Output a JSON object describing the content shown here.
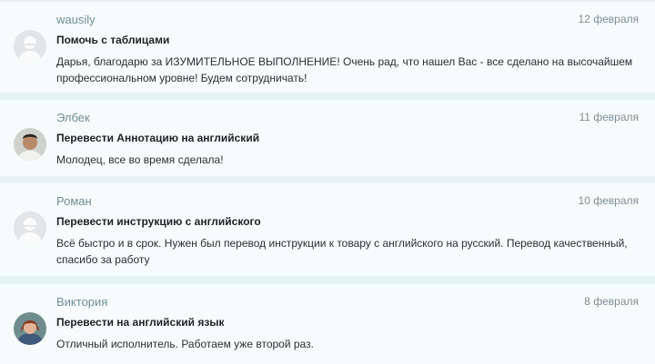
{
  "reviews": [
    {
      "name": "wausily",
      "date": "12 февраля",
      "title": "Помочь с таблицами",
      "text": "Дарья, благодарю за ИЗУМИТЕЛЬНОЕ ВЫПОЛНЕНИЕ! Очень рад, что нашел Вас - все сделано на высочайшем профессиональном уровне! Будем сотрудничать!",
      "avatar": "default-avatar-icon"
    },
    {
      "name": "Элбек",
      "date": "11 февраля",
      "title": "Перевести Аннотацию на английский",
      "text": "Молодец, все во время сделала!",
      "avatar": "user-photo"
    },
    {
      "name": "Роман",
      "date": "10 февраля",
      "title": "Перевести инструкцию с английского",
      "text": "Всё быстро и в срок. Нужен был перевод инструкции к товару с английского на русский. Перевод качественный, спасибо за работу",
      "avatar": "default-avatar-icon"
    },
    {
      "name": "Виктория",
      "date": "8 февраля",
      "title": "Перевести на английский язык",
      "text": "Отличный исполнитель. Работаем уже второй раз.",
      "avatar": "user-photo"
    }
  ]
}
